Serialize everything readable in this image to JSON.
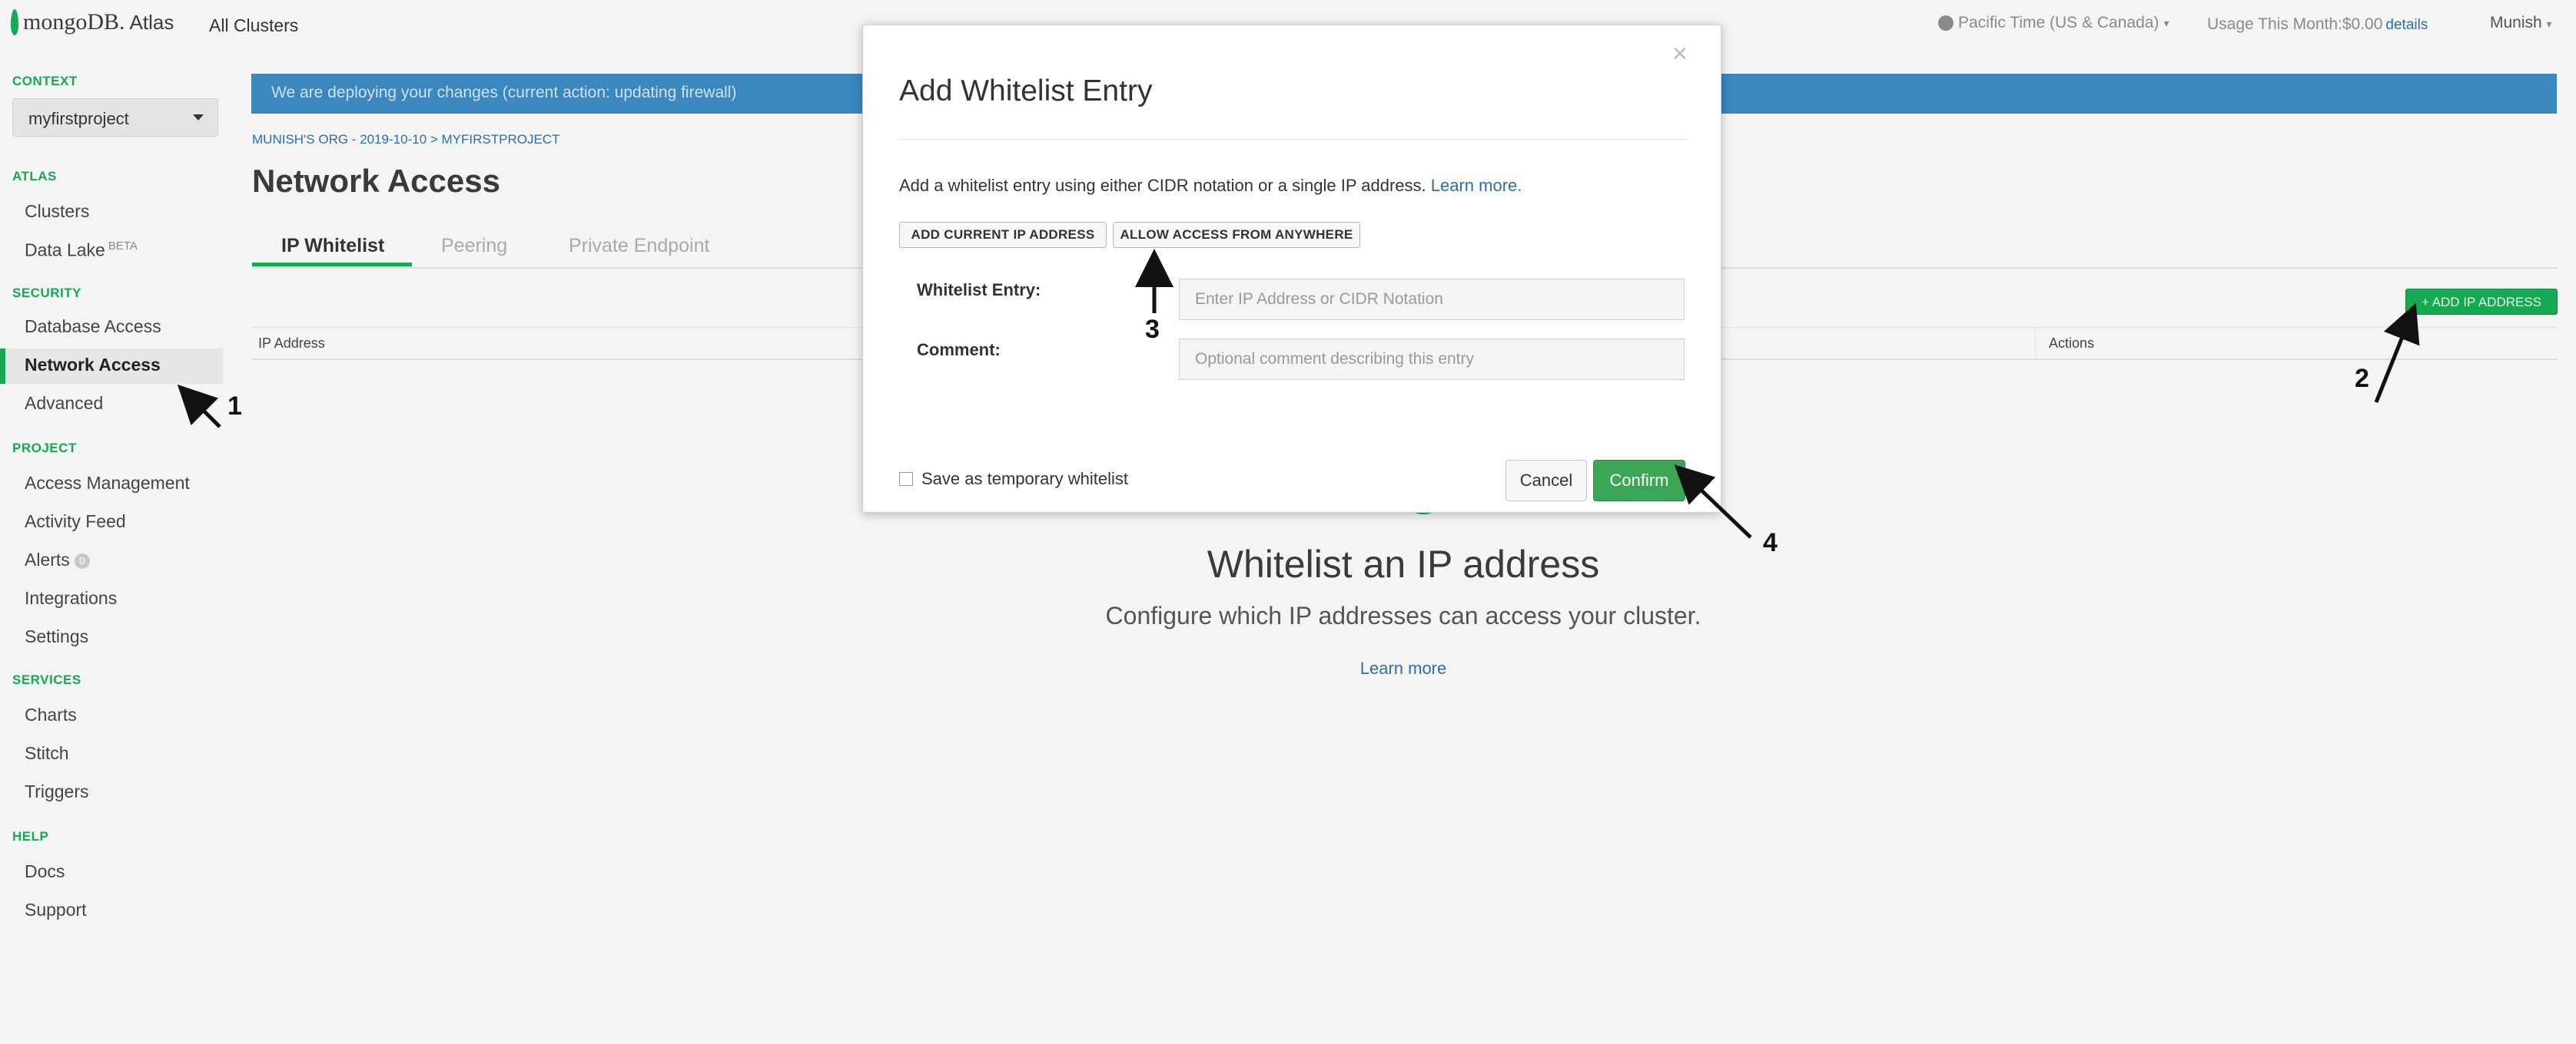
{
  "topbar": {
    "logo_mongo": "mongoDB.",
    "logo_atlas": "Atlas",
    "all_clusters": "All Clusters",
    "timezone": "Pacific Time (US & Canada)",
    "usage_text": "Usage This Month:$0.00",
    "usage_link": "details",
    "user": "Munish"
  },
  "sidebar": {
    "context_label": "CONTEXT",
    "context_value": "myfirstproject",
    "atlas_label": "ATLAS",
    "clusters": "Clusters",
    "data_lake": "Data Lake",
    "data_lake_badge": "BETA",
    "security_label": "SECURITY",
    "database_access": "Database Access",
    "network_access": "Network Access",
    "advanced": "Advanced",
    "project_label": "PROJECT",
    "access_management": "Access Management",
    "activity_feed": "Activity Feed",
    "alerts": "Alerts",
    "alerts_count": "0",
    "integrations": "Integrations",
    "settings": "Settings",
    "services_label": "SERVICES",
    "charts": "Charts",
    "stitch": "Stitch",
    "triggers": "Triggers",
    "help_label": "HELP",
    "docs": "Docs",
    "support": "Support"
  },
  "main": {
    "banner": "We are deploying your changes (current action: updating firewall)",
    "breadcrumb": "MUNISH'S ORG - 2019-10-10 > MYFIRSTPROJECT",
    "title": "Network Access",
    "tabs": [
      "IP Whitelist",
      "Peering",
      "Private Endpoint"
    ],
    "add_ip_button": "+ ADD IP ADDRESS",
    "col_ip": "IP Address",
    "col_actions": "Actions",
    "empty_title": "Whitelist an IP address",
    "empty_sub": "Configure which IP addresses can access your cluster.",
    "empty_link": "Learn more"
  },
  "modal": {
    "title": "Add Whitelist Entry",
    "close": "×",
    "description": "Add a whitelist entry using either CIDR notation or a single IP address.",
    "learn_more": "Learn more.",
    "add_current_ip": "ADD CURRENT IP ADDRESS",
    "allow_anywhere": "ALLOW ACCESS FROM ANYWHERE",
    "entry_label": "Whitelist Entry:",
    "entry_placeholder": "Enter IP Address or CIDR Notation",
    "comment_label": "Comment:",
    "comment_placeholder": "Optional comment describing this entry",
    "temp_label": "Save as temporary whitelist",
    "cancel": "Cancel",
    "confirm": "Confirm"
  },
  "annotations": [
    "1",
    "2",
    "3",
    "4"
  ]
}
